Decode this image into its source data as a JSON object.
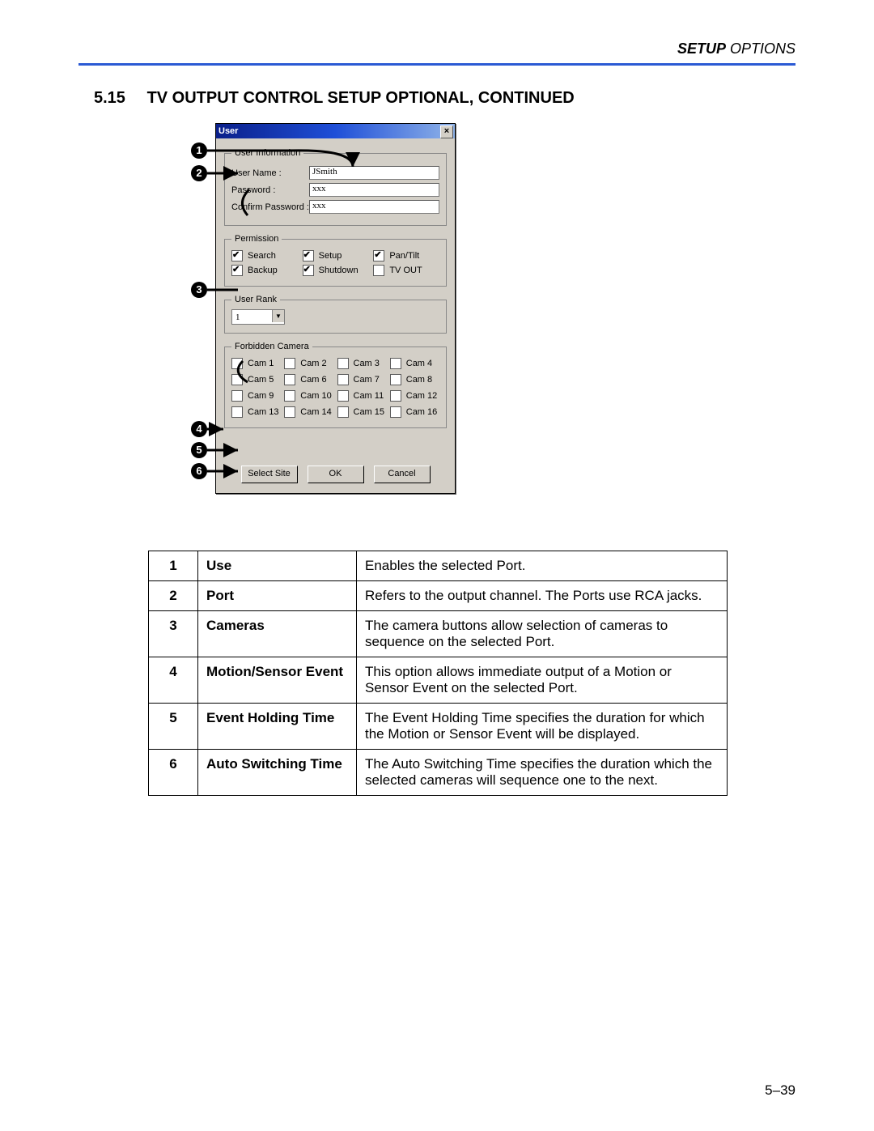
{
  "header": {
    "prefix": "SETUP",
    "suffix": " OPTIONS"
  },
  "section": {
    "number": "5.15",
    "title": "TV OUTPUT CONTROL SETUP OPTIONAL, CONTINUED"
  },
  "dialog": {
    "title": "User",
    "userInfo": {
      "legend": "User Information",
      "userNameLabel": "User Name :",
      "userNameValue": "JSmith",
      "passwordLabel": "Password :",
      "passwordValue": "xxx",
      "confirmLabel": "Confirm Password :",
      "confirmValue": "xxx"
    },
    "permission": {
      "legend": "Permission",
      "items": [
        {
          "label": "Search",
          "checked": true
        },
        {
          "label": "Setup",
          "checked": true
        },
        {
          "label": "Pan/Tilt",
          "checked": true
        },
        {
          "label": "Backup",
          "checked": true
        },
        {
          "label": "Shutdown",
          "checked": true
        },
        {
          "label": "TV OUT",
          "checked": false
        }
      ]
    },
    "userRank": {
      "legend": "User Rank",
      "value": "1"
    },
    "forbidden": {
      "legend": "Forbidden Camera",
      "cams": [
        "Cam 1",
        "Cam 2",
        "Cam 3",
        "Cam 4",
        "Cam 5",
        "Cam 6",
        "Cam 7",
        "Cam 8",
        "Cam 9",
        "Cam 10",
        "Cam 11",
        "Cam 12",
        "Cam 13",
        "Cam 14",
        "Cam 15",
        "Cam 16"
      ]
    },
    "buttons": {
      "selectSite": "Select Site",
      "ok": "OK",
      "cancel": "Cancel"
    }
  },
  "callouts": [
    "1",
    "2",
    "3",
    "4",
    "5",
    "6"
  ],
  "legend": [
    {
      "n": "1",
      "term": "Use",
      "desc": "Enables the selected Port."
    },
    {
      "n": "2",
      "term": "Port",
      "desc": "Refers to the output channel. The Ports use RCA jacks."
    },
    {
      "n": "3",
      "term": "Cameras",
      "desc": "The camera buttons allow selection of cameras to sequence on the selected Port."
    },
    {
      "n": "4",
      "term": "Motion/Sensor Event",
      "desc": "This option allows immediate output of a Motion or Sensor Event on the selected Port."
    },
    {
      "n": "5",
      "term": "Event Holding Time",
      "desc": "The Event Holding Time specifies the duration for which the Motion or Sensor Event will be displayed."
    },
    {
      "n": "6",
      "term": "Auto Switching Time",
      "desc": "The Auto Switching Time specifies the duration which the selected cameras will sequence one to the next."
    }
  ],
  "pageNumber": "5–39"
}
